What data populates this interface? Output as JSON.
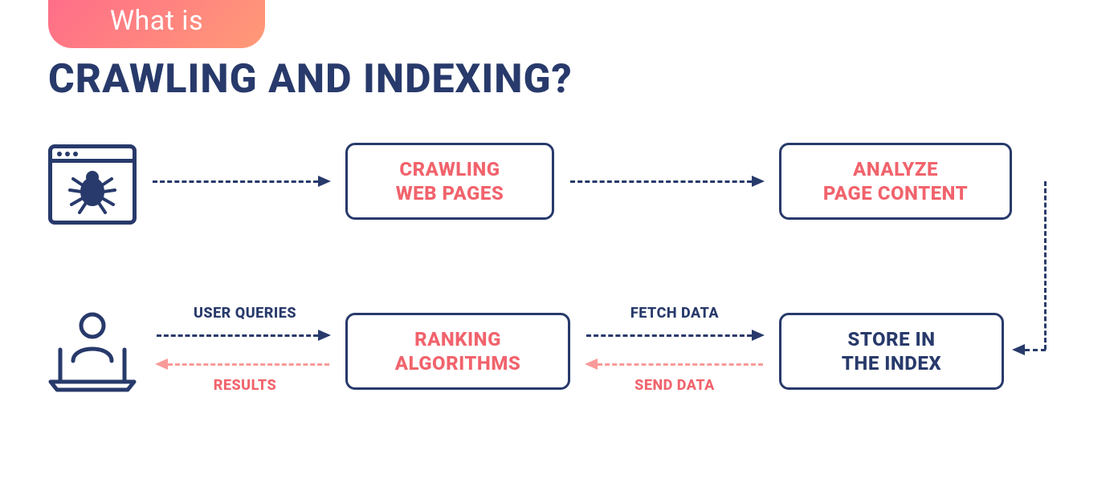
{
  "header": {
    "badge": "What is",
    "title": "CRAWLING AND INDEXING?"
  },
  "nodes": {
    "crawling": {
      "line1": "CRAWLING",
      "line2": "WEB PAGES"
    },
    "analyze": {
      "line1": "ANALYZE",
      "line2": "PAGE CONTENT"
    },
    "ranking": {
      "line1": "RANKING",
      "line2": "ALGORITHMS"
    },
    "store": {
      "line1": "STORE IN",
      "line2": "THE INDEX"
    }
  },
  "labels": {
    "user_queries": "USER QUERIES",
    "results": "RESULTS",
    "fetch_data": "FETCH DATA",
    "send_data": "SEND DATA"
  },
  "icons": {
    "crawler": "spider-browser-icon",
    "user": "user-laptop-icon"
  },
  "colors": {
    "navy": "#283A6B",
    "red": "#F1636C",
    "pink": "#F99A9A"
  }
}
